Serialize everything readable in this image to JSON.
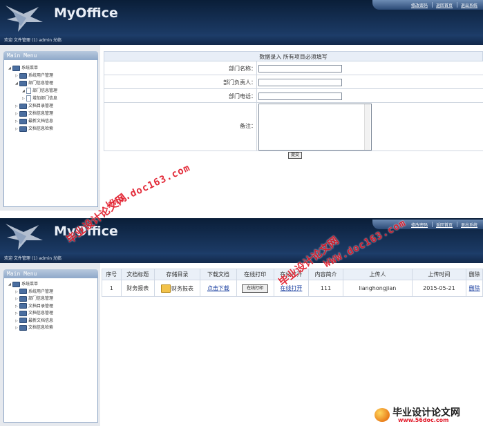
{
  "app": {
    "logo": "MyOffice",
    "top_links": [
      "修改密码",
      "返回首页",
      "退出系统"
    ],
    "welcome": "欢迎 文件管理 (1) admin 光临"
  },
  "menu": {
    "title": "Main Menu"
  },
  "screen1": {
    "tree": [
      {
        "label": "系统菜单",
        "level": 0,
        "expanded": true,
        "icon": "folder-icon"
      },
      {
        "label": "系统用户管理",
        "level": 1,
        "expanded": false,
        "icon": "folder-icon"
      },
      {
        "label": "部门信息管理",
        "level": 1,
        "expanded": true,
        "icon": "folder-icon"
      },
      {
        "label": "部门信息管理",
        "level": 2,
        "expanded": true,
        "icon": "doc-icon"
      },
      {
        "label": "增加部门信息",
        "level": 2,
        "expanded": false,
        "icon": "doc-icon"
      },
      {
        "label": "文档目录管理",
        "level": 1,
        "expanded": false,
        "icon": "folder-icon"
      },
      {
        "label": "文档信息管理",
        "level": 1,
        "expanded": false,
        "icon": "folder-icon"
      },
      {
        "label": "最新文档信息",
        "level": 1,
        "expanded": false,
        "icon": "folder-icon"
      },
      {
        "label": "文档信息检索",
        "level": 1,
        "expanded": false,
        "icon": "folder-icon"
      }
    ],
    "form": {
      "title": "数据录入  所有项目必须填写",
      "fields": [
        {
          "label": "部门名称：",
          "value": ""
        },
        {
          "label": "部门负责人：",
          "value": ""
        },
        {
          "label": "部门电话：",
          "value": ""
        }
      ],
      "remark_label": "备注：",
      "remark_value": "",
      "submit_label": "提交"
    }
  },
  "screen2": {
    "tree": [
      {
        "label": "系统菜单",
        "level": 0,
        "expanded": true,
        "icon": "folder-icon"
      },
      {
        "label": "系统用户管理",
        "level": 1,
        "expanded": false,
        "icon": "folder-icon"
      },
      {
        "label": "部门信息管理",
        "level": 1,
        "expanded": false,
        "icon": "folder-icon"
      },
      {
        "label": "文档目录管理",
        "level": 1,
        "expanded": false,
        "icon": "folder-icon"
      },
      {
        "label": "文档信息管理",
        "level": 1,
        "expanded": false,
        "icon": "folder-icon"
      },
      {
        "label": "最新文档信息",
        "level": 1,
        "expanded": false,
        "icon": "folder-icon"
      },
      {
        "label": "文档信息检索",
        "level": 1,
        "expanded": false,
        "icon": "folder-icon"
      }
    ],
    "table": {
      "headers": [
        "序号",
        "文档标题",
        "存储目录",
        "下载文档",
        "在线打印",
        "在线打开",
        "内容简介",
        "上传人",
        "上传时间",
        "删除"
      ],
      "rows": [
        {
          "index": "1",
          "title": "财务报表",
          "folder": "财务报表",
          "download": "点击下载",
          "print": "在线打印",
          "open": "在线打开",
          "intro": "111",
          "uploader": "lianghongjian",
          "time": "2015-05-21",
          "delete": "删除"
        }
      ]
    }
  },
  "watermarks": {
    "url": "WWW.doc163.com",
    "cn": "毕业设计论文网",
    "corner_cn": "毕业设计论文网",
    "corner_url": "www.56doc.com"
  },
  "colors": {
    "header_dark": "#0a1e38",
    "header_light": "#1c3b66",
    "menu_head": "#8ea8c9",
    "link": "#1a3fa0",
    "watermark": "#e11b2a"
  }
}
